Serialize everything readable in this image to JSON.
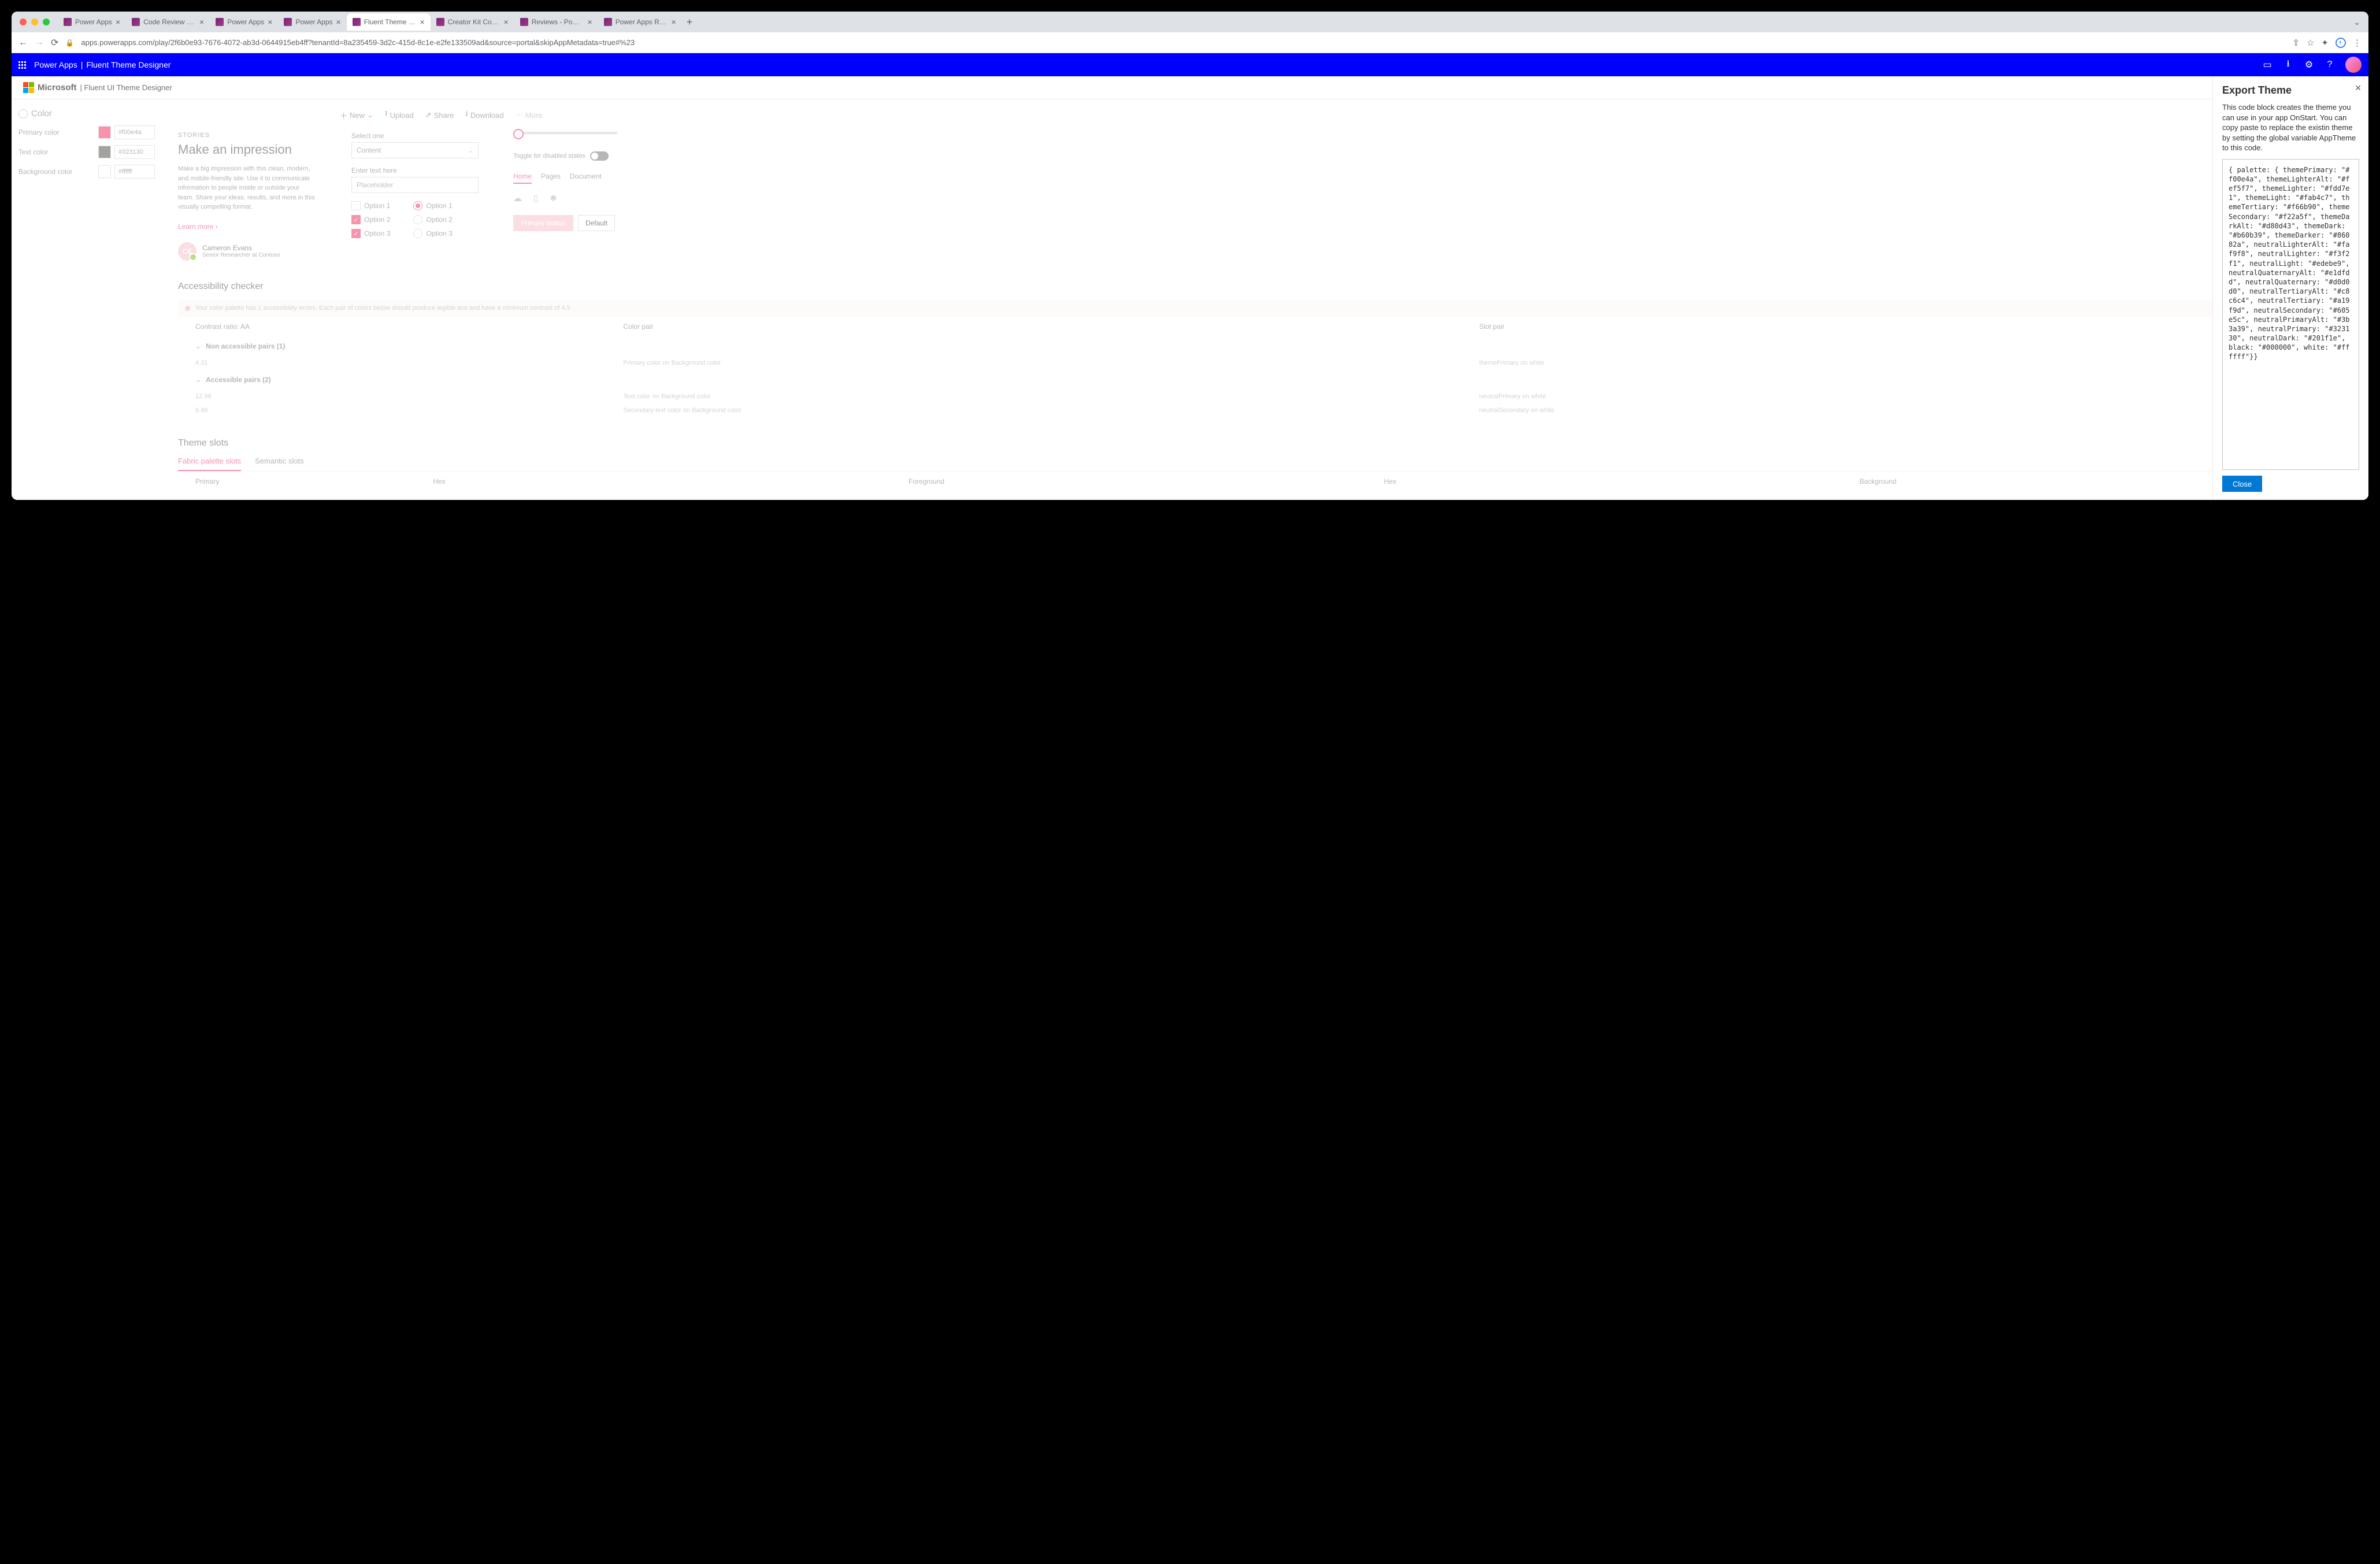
{
  "browser": {
    "tabs": [
      {
        "title": "Power Apps"
      },
      {
        "title": "Code Review Tool Experim"
      },
      {
        "title": "Power Apps"
      },
      {
        "title": "Power Apps"
      },
      {
        "title": "Fluent Theme Designer - P",
        "active": true
      },
      {
        "title": "Creator Kit Control Referen"
      },
      {
        "title": "Reviews - Power Apps"
      },
      {
        "title": "Power Apps Review Tool -"
      }
    ],
    "url": "apps.powerapps.com/play/2f6b0e93-7676-4072-ab3d-0644915eb4ff?tenantId=8a235459-3d2c-415d-8c1e-e2fe133509ad&source=portal&skipAppMetadata=true#%23"
  },
  "appbar": {
    "product": "Power Apps",
    "page": "Fluent Theme Designer"
  },
  "header": {
    "brand": "Microsoft",
    "product": "Fluent UI Theme Designer"
  },
  "color": {
    "heading": "Color",
    "rows": [
      {
        "label": "Primary color",
        "hex": "#f00e4a"
      },
      {
        "label": "Text color",
        "hex": "#323130"
      },
      {
        "label": "Background color",
        "hex": "#ffffff"
      }
    ]
  },
  "cmdbar": {
    "new": "New",
    "upload": "Upload",
    "share": "Share",
    "download": "Download",
    "more": "More"
  },
  "story": {
    "label": "STORIES",
    "title": "Make an impression",
    "body": "Make a big impression with this clean, modern, and mobile-friendly site. Use it to communicate information to people inside or outside your team. Share your ideas, results, and more in this visually compelling format.",
    "learn": "Learn more",
    "persona_name": "Cameron Evans",
    "persona_sub": "Senior Researcher at Contoso",
    "initials": "CE"
  },
  "form": {
    "select_label": "Select one",
    "select_value": "Content",
    "text_label": "Enter text here",
    "text_placeholder": "Placeholder",
    "chk_opts": [
      "Option 1",
      "Option 2",
      "Option 3"
    ],
    "radio_opts": [
      "Option 1",
      "Option 2",
      "Option 3"
    ]
  },
  "right": {
    "toggle_label": "Toggle for disabled states",
    "tabs": [
      "Home",
      "Pages",
      "Document"
    ],
    "primary_btn": "Primary button",
    "default_btn": "Default"
  },
  "a11y": {
    "heading": "Accessibility checker",
    "banner": "Your color palette has 1 accessibility errors. Each pair of colors below should produce legible text and have a minimum contrast of 4.5",
    "cols": [
      "Contrast ratio: AA",
      "Color pair",
      "Slot pair"
    ],
    "non_heading": "Non accessible pairs (1)",
    "non_rows": [
      {
        "ratio": "4.31",
        "pair": "Primary color on Background color",
        "slot": "themePrimary on white"
      }
    ],
    "acc_heading": "Accessible pairs (2)",
    "acc_rows": [
      {
        "ratio": "12.98",
        "pair": "Text color on Background color",
        "slot": "neutralPrimary on white"
      },
      {
        "ratio": "6.46",
        "pair": "Secondary text color on Background color",
        "slot": "neutralSecondary on white"
      }
    ]
  },
  "slots": {
    "heading": "Theme slots",
    "pivots": [
      "Fabric palette slots",
      "Semantic slots"
    ],
    "cols": [
      "Primary",
      "Hex",
      "Foreground",
      "Hex",
      "Background"
    ]
  },
  "panel": {
    "title": "Export Theme",
    "desc": "This code block creates the theme you can use in your app OnStart. You can copy paste to replace the existin theme by setting the global variable AppTheme to this code.",
    "code": "{ palette: { themePrimary: \"#f00e4a\", themeLighterAlt: \"#fef5f7\", themeLighter: \"#fdd7e1\", themeLight: \"#fab4c7\", themeTertiary: \"#f66b90\", themeSecondary: \"#f22a5f\", themeDarkAlt: \"#d80d43\", themeDark: \"#b60b39\", themeDarker: \"#86082a\", neutralLighterAlt: \"#faf9f8\", neutralLighter: \"#f3f2f1\", neutralLight: \"#edebe9\", neutralQuaternaryAlt: \"#e1dfdd\", neutralQuaternary: \"#d0d0d0\", neutralTertiaryAlt: \"#c8c6c4\", neutralTertiary: \"#a19f9d\", neutralSecondary: \"#605e5c\", neutralPrimaryAlt: \"#3b3a39\", neutralPrimary: \"#323130\", neutralDark: \"#201f1e\", black: \"#000000\", white: \"#ffffff\"}}",
    "close_btn": "Close"
  }
}
